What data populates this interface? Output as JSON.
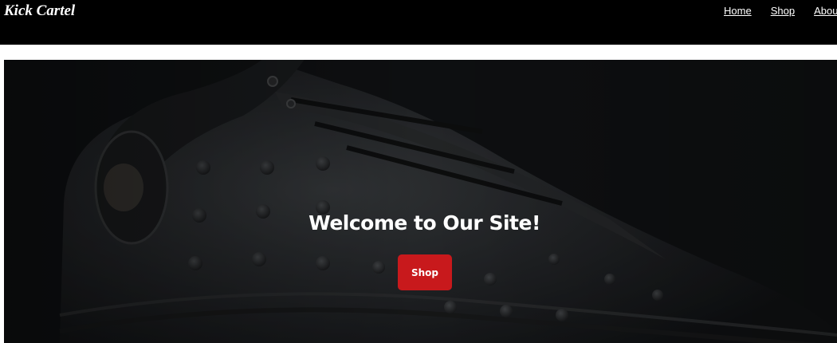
{
  "header": {
    "brand": "Kick Cartel",
    "nav": [
      {
        "label": "Home"
      },
      {
        "label": "Shop"
      },
      {
        "label": "Abou"
      }
    ]
  },
  "hero": {
    "title": "Welcome to Our Site!",
    "button_label": "Shop",
    "button_color": "#c8191c",
    "background_color": "#101214"
  }
}
